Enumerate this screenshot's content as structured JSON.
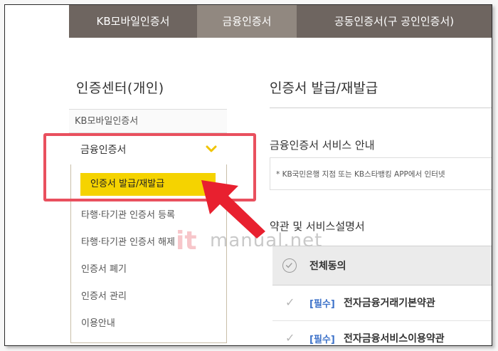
{
  "tabs": [
    {
      "label": "KB모바일인증서"
    },
    {
      "label": "금융인증서"
    },
    {
      "label": "공동인증서(구 공인인증서)"
    }
  ],
  "sidebar": {
    "title": "인증센터(개인)",
    "top_item": "KB모바일인증서",
    "active_item": "금융인증서",
    "submenu": [
      {
        "label": "인증서 발급/재발급"
      },
      {
        "label": "타행·타기관 인증서 등록"
      },
      {
        "label": "타행·타기관 인증서 해제"
      },
      {
        "label": "인증서 폐기"
      },
      {
        "label": "인증서 관리"
      },
      {
        "label": "이용안내"
      }
    ]
  },
  "main": {
    "title": "인증서 발급/재발급",
    "section_title": "금융인증서 서비스 안내",
    "notice": "* KB국민은행 지점 또는 KB스타뱅킹 APP에서 인터넷",
    "terms_title": "약관 및 서비스설명서",
    "agree_all": "전체동의",
    "terms": [
      {
        "required": "[필수]",
        "name": "전자금융거래기본약관"
      },
      {
        "required": "[필수]",
        "name": "전자금융서비스이용약관"
      }
    ]
  },
  "watermark": {
    "logo": "it",
    "text": "manual.net"
  },
  "colors": {
    "tab_dark": "#6e6560",
    "tab_active": "#918880",
    "highlight": "#f5d300",
    "annotation_red": "#e9505e",
    "required_blue": "#3d72c9"
  }
}
